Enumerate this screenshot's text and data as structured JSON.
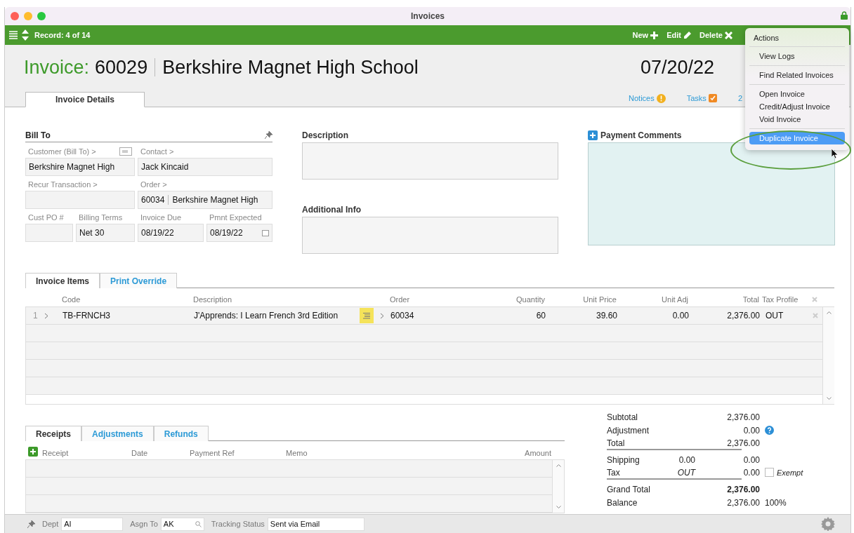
{
  "window": {
    "title": "Invoices"
  },
  "toolbar": {
    "record": "Record: 4 of 14",
    "actions": [
      {
        "label": "New",
        "kind": "new"
      },
      {
        "label": "Edit",
        "kind": "edit"
      },
      {
        "label": "Delete",
        "kind": "delete"
      }
    ]
  },
  "header": {
    "prefix": "Invoice:",
    "number": "60029",
    "customer": "Berkshire Magnet High School",
    "date": "07/20/22"
  },
  "tabs": [
    {
      "label": "Invoice Details",
      "selected": true
    }
  ],
  "links": [
    {
      "label": "Notices",
      "kind": "notice"
    },
    {
      "label": "Tasks",
      "kind": "task"
    },
    {
      "label": "2",
      "kind": "plain"
    }
  ],
  "bill_to": {
    "title": "Bill To",
    "fields": [
      {
        "label": "Customer (Bill To) >",
        "value": "Berkshire Magnet High",
        "wide": true,
        "kind": "card"
      },
      {
        "label": "Contact >",
        "value": "Jack Kincaid",
        "wide": true,
        "kind": "text"
      },
      {
        "label": "Recur Transaction >",
        "wide": true,
        "kind": "text"
      },
      {
        "label": "Order >",
        "value": "60034",
        "value_extra": "Berkshire Magnet High",
        "wide": true,
        "kind": "text"
      },
      {
        "label": "Cust PO #",
        "wide": false,
        "kind": "text"
      },
      {
        "label": "Billing Terms",
        "value": "Net 30",
        "wide": false,
        "kind": "text"
      },
      {
        "label": "Invoice Due",
        "value": "08/19/22",
        "wide": false,
        "kind": "text"
      },
      {
        "label": "Pmnt Expected",
        "value": "08/19/22",
        "wide": false,
        "kind": "date"
      }
    ]
  },
  "description": {
    "title": "Description"
  },
  "additional_info": {
    "title": "Additional Info"
  },
  "payment_comments": {
    "title": "Payment Comments"
  },
  "items": {
    "tabs": [
      {
        "label": "Invoice Items",
        "selected": true
      },
      {
        "label": "Print Override",
        "selected": false
      }
    ],
    "columns": [
      "Code",
      "Description",
      "Order",
      "Quantity",
      "Unit Price",
      "Unit Adj",
      "Total",
      "Tax Profile"
    ],
    "rows": [
      {
        "line": "1",
        "code": "TB-FRNCH3",
        "description": "J'Apprends: I Learn French 3rd Edition",
        "order": "60034",
        "quantity": "60",
        "unit_price": "39.60",
        "unit_adj": "0.00",
        "total": "2,376.00",
        "tax_profile": "OUT"
      }
    ]
  },
  "receipts": {
    "tabs": [
      {
        "label": "Receipts",
        "selected": true
      },
      {
        "label": "Adjustments",
        "selected": false
      },
      {
        "label": "Refunds",
        "selected": false
      }
    ],
    "columns": [
      "Receipt",
      "Date",
      "Payment Ref",
      "Memo",
      "Amount"
    ]
  },
  "totals": [
    {
      "label": "Subtotal",
      "value": "2,376.00",
      "kind": "plain"
    },
    {
      "label": "Adjustment",
      "value": "0.00",
      "kind": "help"
    },
    {
      "label": "Total",
      "value": "2,376.00",
      "kind": "rule"
    },
    {
      "label": "Shipping",
      "middle": "0.00",
      "value": "0.00",
      "kind": "plain"
    },
    {
      "label": "Tax",
      "middle": "OUT",
      "value": "0.00",
      "kind": "exempt",
      "extra": "Exempt",
      "checked": false
    },
    {
      "label": "Grand Total",
      "value": "2,376.00",
      "kind": "grand"
    },
    {
      "label": "Balance",
      "value": "2,376.00",
      "extra": "100%",
      "kind": "plain"
    }
  ],
  "status_bar": {
    "fields": [
      {
        "label": "Dept",
        "value": "AI",
        "kind": "text"
      },
      {
        "label": "Asgn To",
        "value": "AK",
        "kind": "search"
      },
      {
        "label": "Tracking Status",
        "value": "Sent via Email",
        "kind": "text"
      }
    ]
  },
  "menu": {
    "title": "Actions",
    "groups": [
      {
        "items": [
          {
            "label": "View Logs",
            "selected": false
          }
        ]
      },
      {
        "items": [
          {
            "label": "Find Related Invoices",
            "selected": false
          }
        ]
      },
      {
        "items": [
          {
            "label": "Open Invoice",
            "selected": false
          },
          {
            "label": "Credit/Adjust Invoice",
            "selected": false
          },
          {
            "label": "Void Invoice",
            "selected": false
          }
        ]
      },
      {
        "items": [
          {
            "label": "Duplicate Invoice",
            "selected": true
          }
        ]
      }
    ]
  }
}
